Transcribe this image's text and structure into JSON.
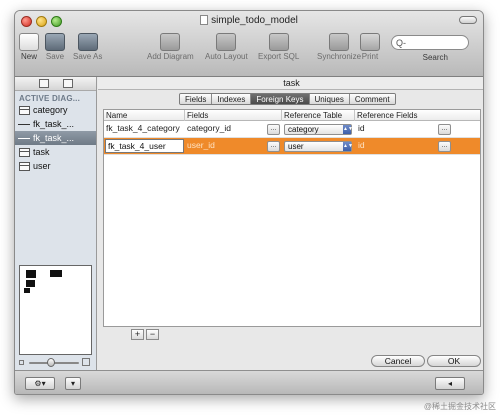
{
  "window": {
    "title": "simple_todo_model"
  },
  "toolbar": {
    "new_label": "New",
    "save_label": "Save",
    "save_as_label": "Save As",
    "add_diagram_label": "Add Diagram",
    "auto_layout_label": "Auto Layout",
    "export_sql_label": "Export SQL",
    "synchronize_label": "Synchronize",
    "print_label": "Print",
    "search_label": "Search",
    "search_icon": "Q-",
    "search_value": ""
  },
  "sidebar": {
    "heading": "ACTIVE DIAG...",
    "items": [
      {
        "label": "category",
        "icon": "table-icon"
      },
      {
        "label": "fk_task_...",
        "icon": "relation-icon"
      },
      {
        "label": "fk_task_...",
        "icon": "relation-icon"
      },
      {
        "label": "task",
        "icon": "table-icon"
      },
      {
        "label": "user",
        "icon": "table-icon"
      }
    ]
  },
  "editor": {
    "table_name": "task",
    "tabs": [
      "Fields",
      "Indexes",
      "Foreign Keys",
      "Uniques",
      "Comment"
    ],
    "active_tab": "Foreign Keys",
    "columns": [
      "Name",
      "Fields",
      "Reference Table",
      "Reference Fields"
    ],
    "rows": [
      {
        "name": "fk_task_4_category",
        "fields": "category_id",
        "ref_table": "category",
        "ref_fields": "id"
      },
      {
        "name": "fk_task_4_user",
        "fields": "user_id",
        "ref_table": "user",
        "ref_fields": "id"
      }
    ],
    "ellipsis": "...",
    "add_label": "+",
    "remove_label": "−",
    "cancel_label": "Cancel",
    "ok_label": "OK"
  },
  "statusbar": {
    "gear_label": "⚙▾",
    "box_label": "▾",
    "right_label": "◂"
  },
  "watermark": "@稀土掘金技术社区",
  "colors": {
    "selection": "#ef8a2a",
    "active_tab": "#5a5a5a"
  }
}
